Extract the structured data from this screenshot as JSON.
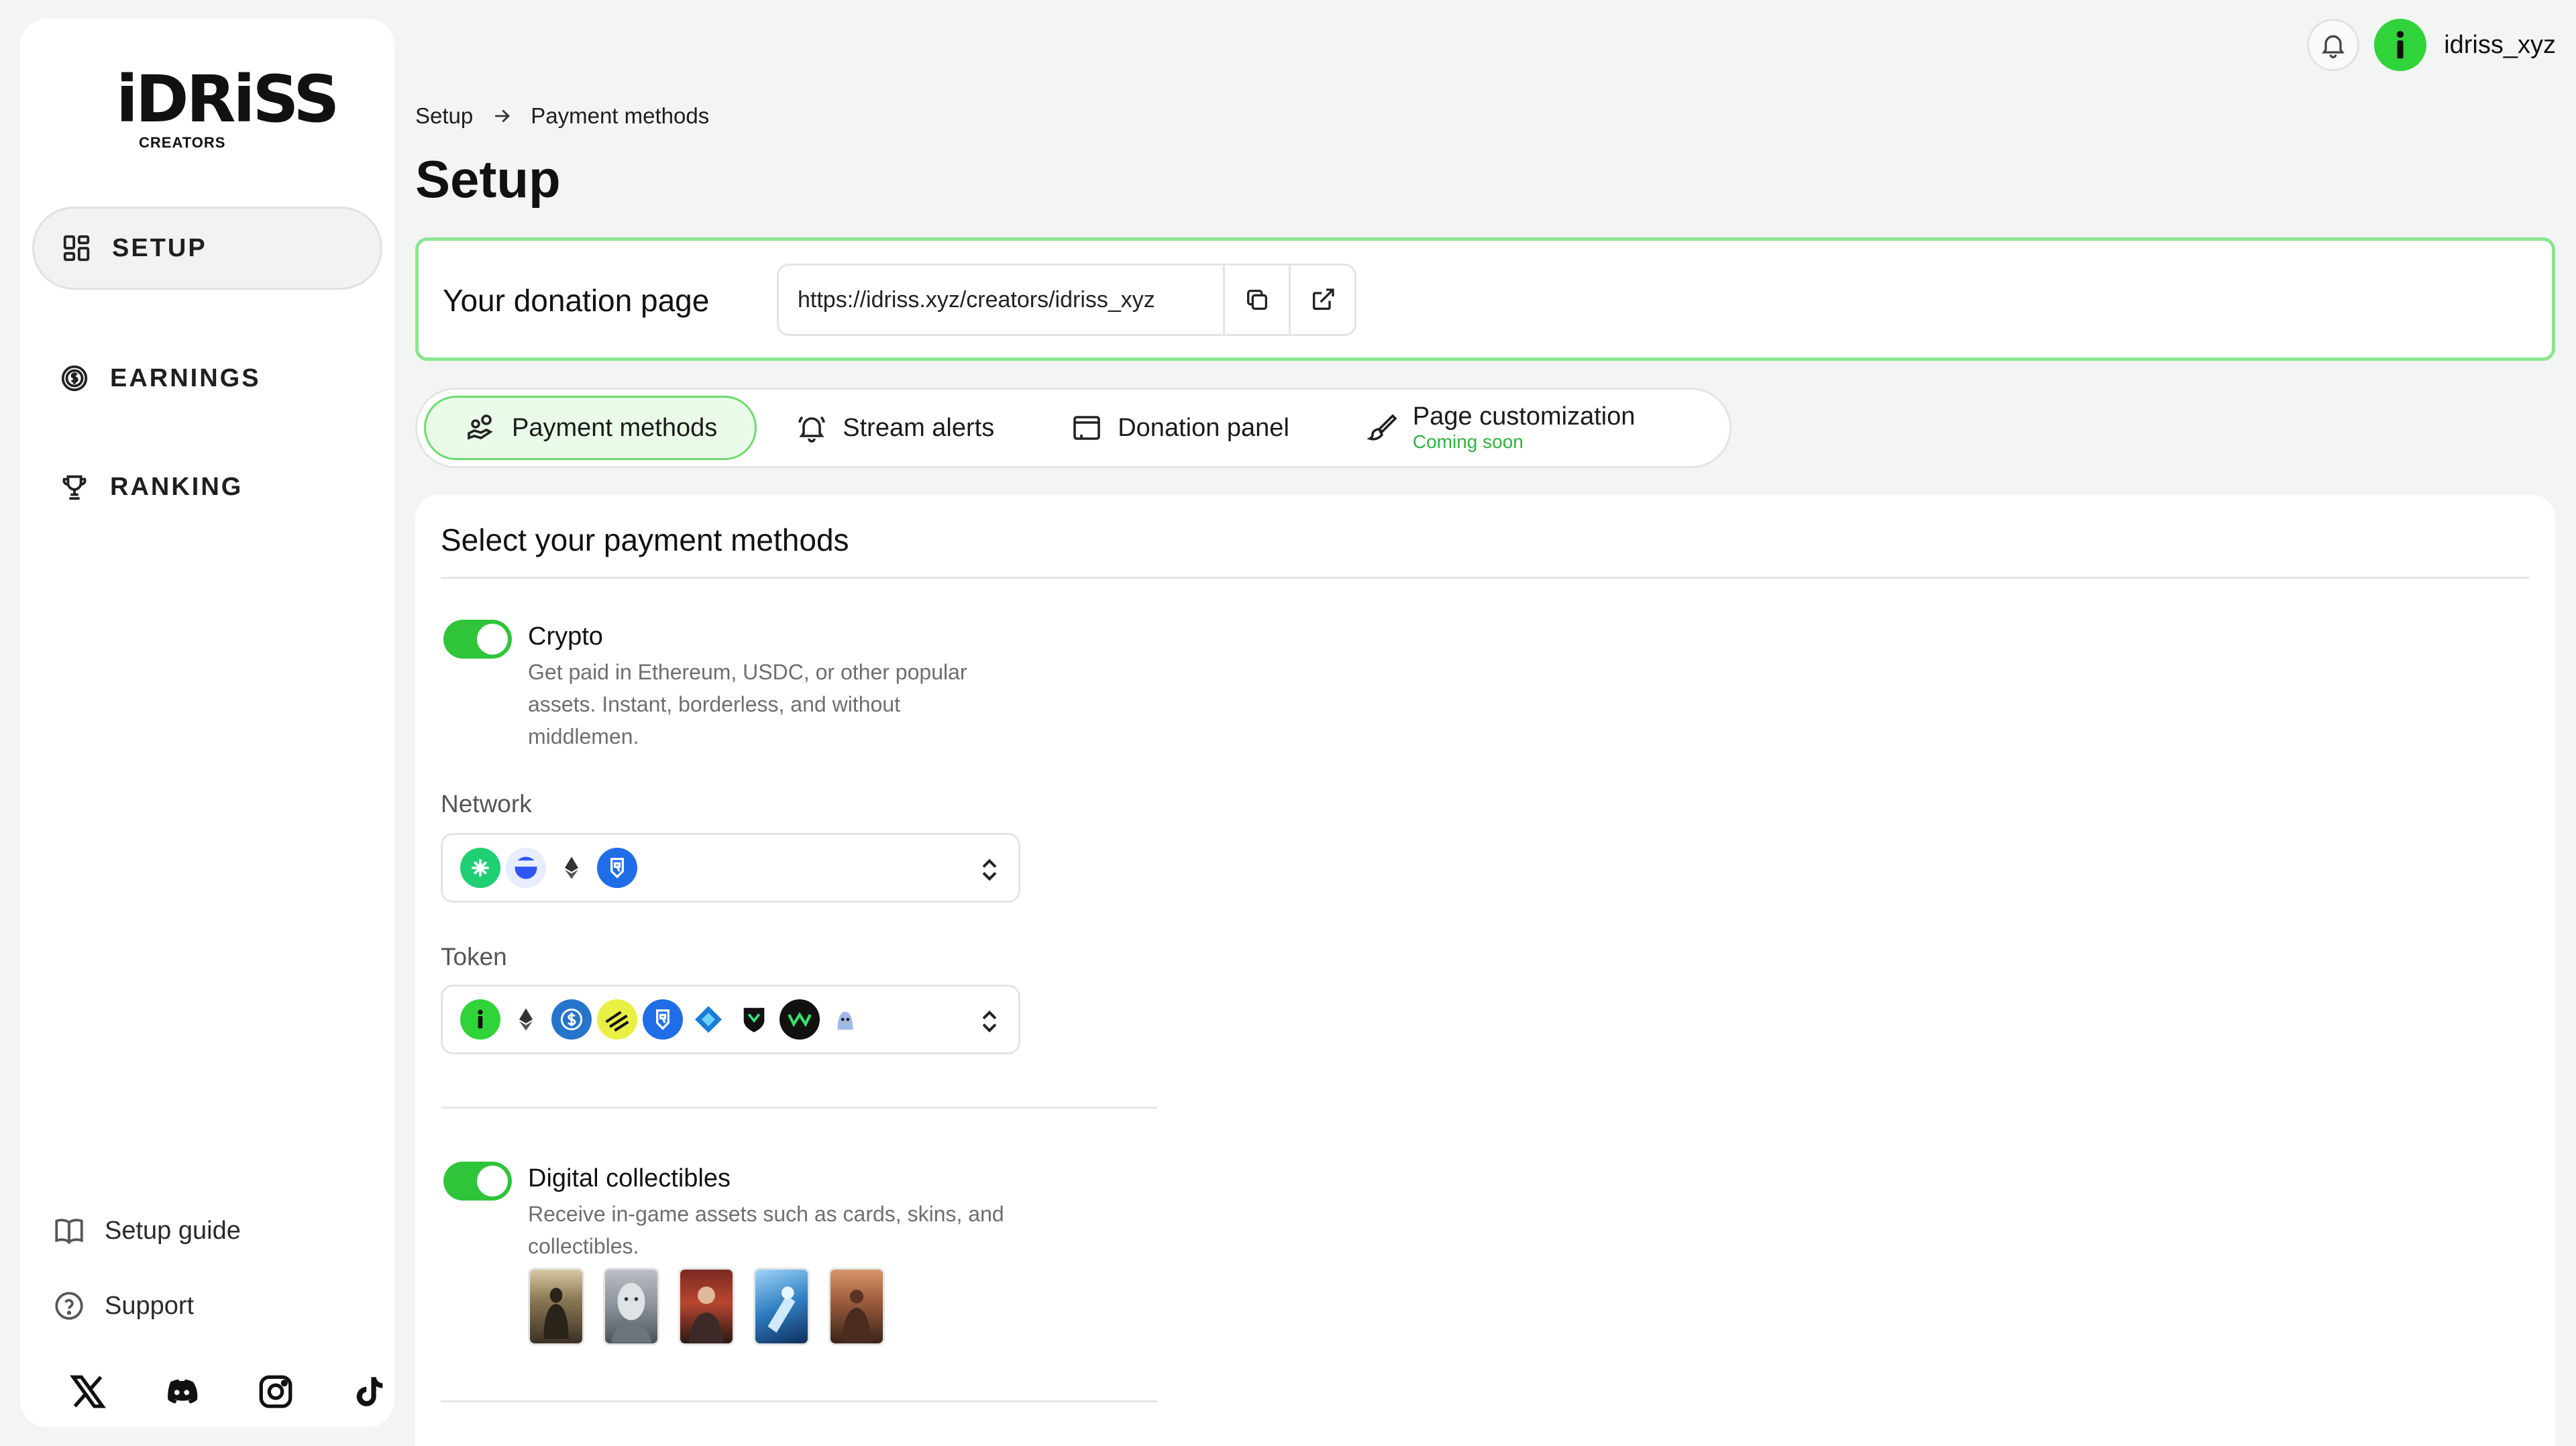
{
  "brand": {
    "name": "iDRiSS",
    "sub": "CREATORS"
  },
  "sidebar": {
    "items": [
      {
        "label": "SETUP",
        "icon": "grid-icon",
        "active": true
      },
      {
        "label": "EARNINGS",
        "icon": "dollar-coin-icon",
        "active": false
      },
      {
        "label": "RANKING",
        "icon": "trophy-icon",
        "active": false
      }
    ],
    "links": [
      {
        "label": "Setup guide",
        "icon": "book-icon"
      },
      {
        "label": "Support",
        "icon": "help-circle-icon"
      }
    ],
    "socials": [
      "x-icon",
      "discord-icon",
      "instagram-icon",
      "tiktok-icon"
    ]
  },
  "header": {
    "username": "idriss_xyz",
    "accent": "#31d33a"
  },
  "breadcrumb": {
    "root": "Setup",
    "current": "Payment methods"
  },
  "page": {
    "title": "Setup"
  },
  "donation": {
    "label": "Your donation page",
    "url": "https://idriss.xyz/creators/idriss_xyz"
  },
  "tabs": [
    {
      "label": "Payment methods",
      "icon": "hand-coins-icon",
      "active": true
    },
    {
      "label": "Stream alerts",
      "icon": "bell-icon",
      "active": false
    },
    {
      "label": "Donation panel",
      "icon": "monitor-icon",
      "active": false
    },
    {
      "label": "Page customization",
      "sub": "Coming soon",
      "icon": "paintbrush-icon",
      "active": false
    }
  ],
  "payments": {
    "title": "Select your payment methods",
    "crypto": {
      "label": "Crypto",
      "enabled": true,
      "description": "Get paid in Ethereum, USDC, or other popular assets. Instant, borderless, and without middlemen."
    },
    "network": {
      "label": "Network",
      "chips": [
        "abstract-icon",
        "base-icon",
        "ethereum-icon",
        "ronin-icon"
      ]
    },
    "token": {
      "label": "Token",
      "chips": [
        "idriss-icon",
        "eth-icon",
        "usdc-icon",
        "pengu-stripes-icon",
        "ronin-icon",
        "diamond-icon",
        "shield-icon",
        "wave-icon",
        "pudgy-icon"
      ]
    },
    "collectibles": {
      "label": "Digital collectibles",
      "enabled": true,
      "description": "Receive in-game assets such as cards, skins, and collectibles.",
      "thumbnails": [
        "card-thumb-1",
        "card-thumb-2",
        "card-thumb-3",
        "card-thumb-4",
        "card-thumb-5"
      ]
    }
  }
}
